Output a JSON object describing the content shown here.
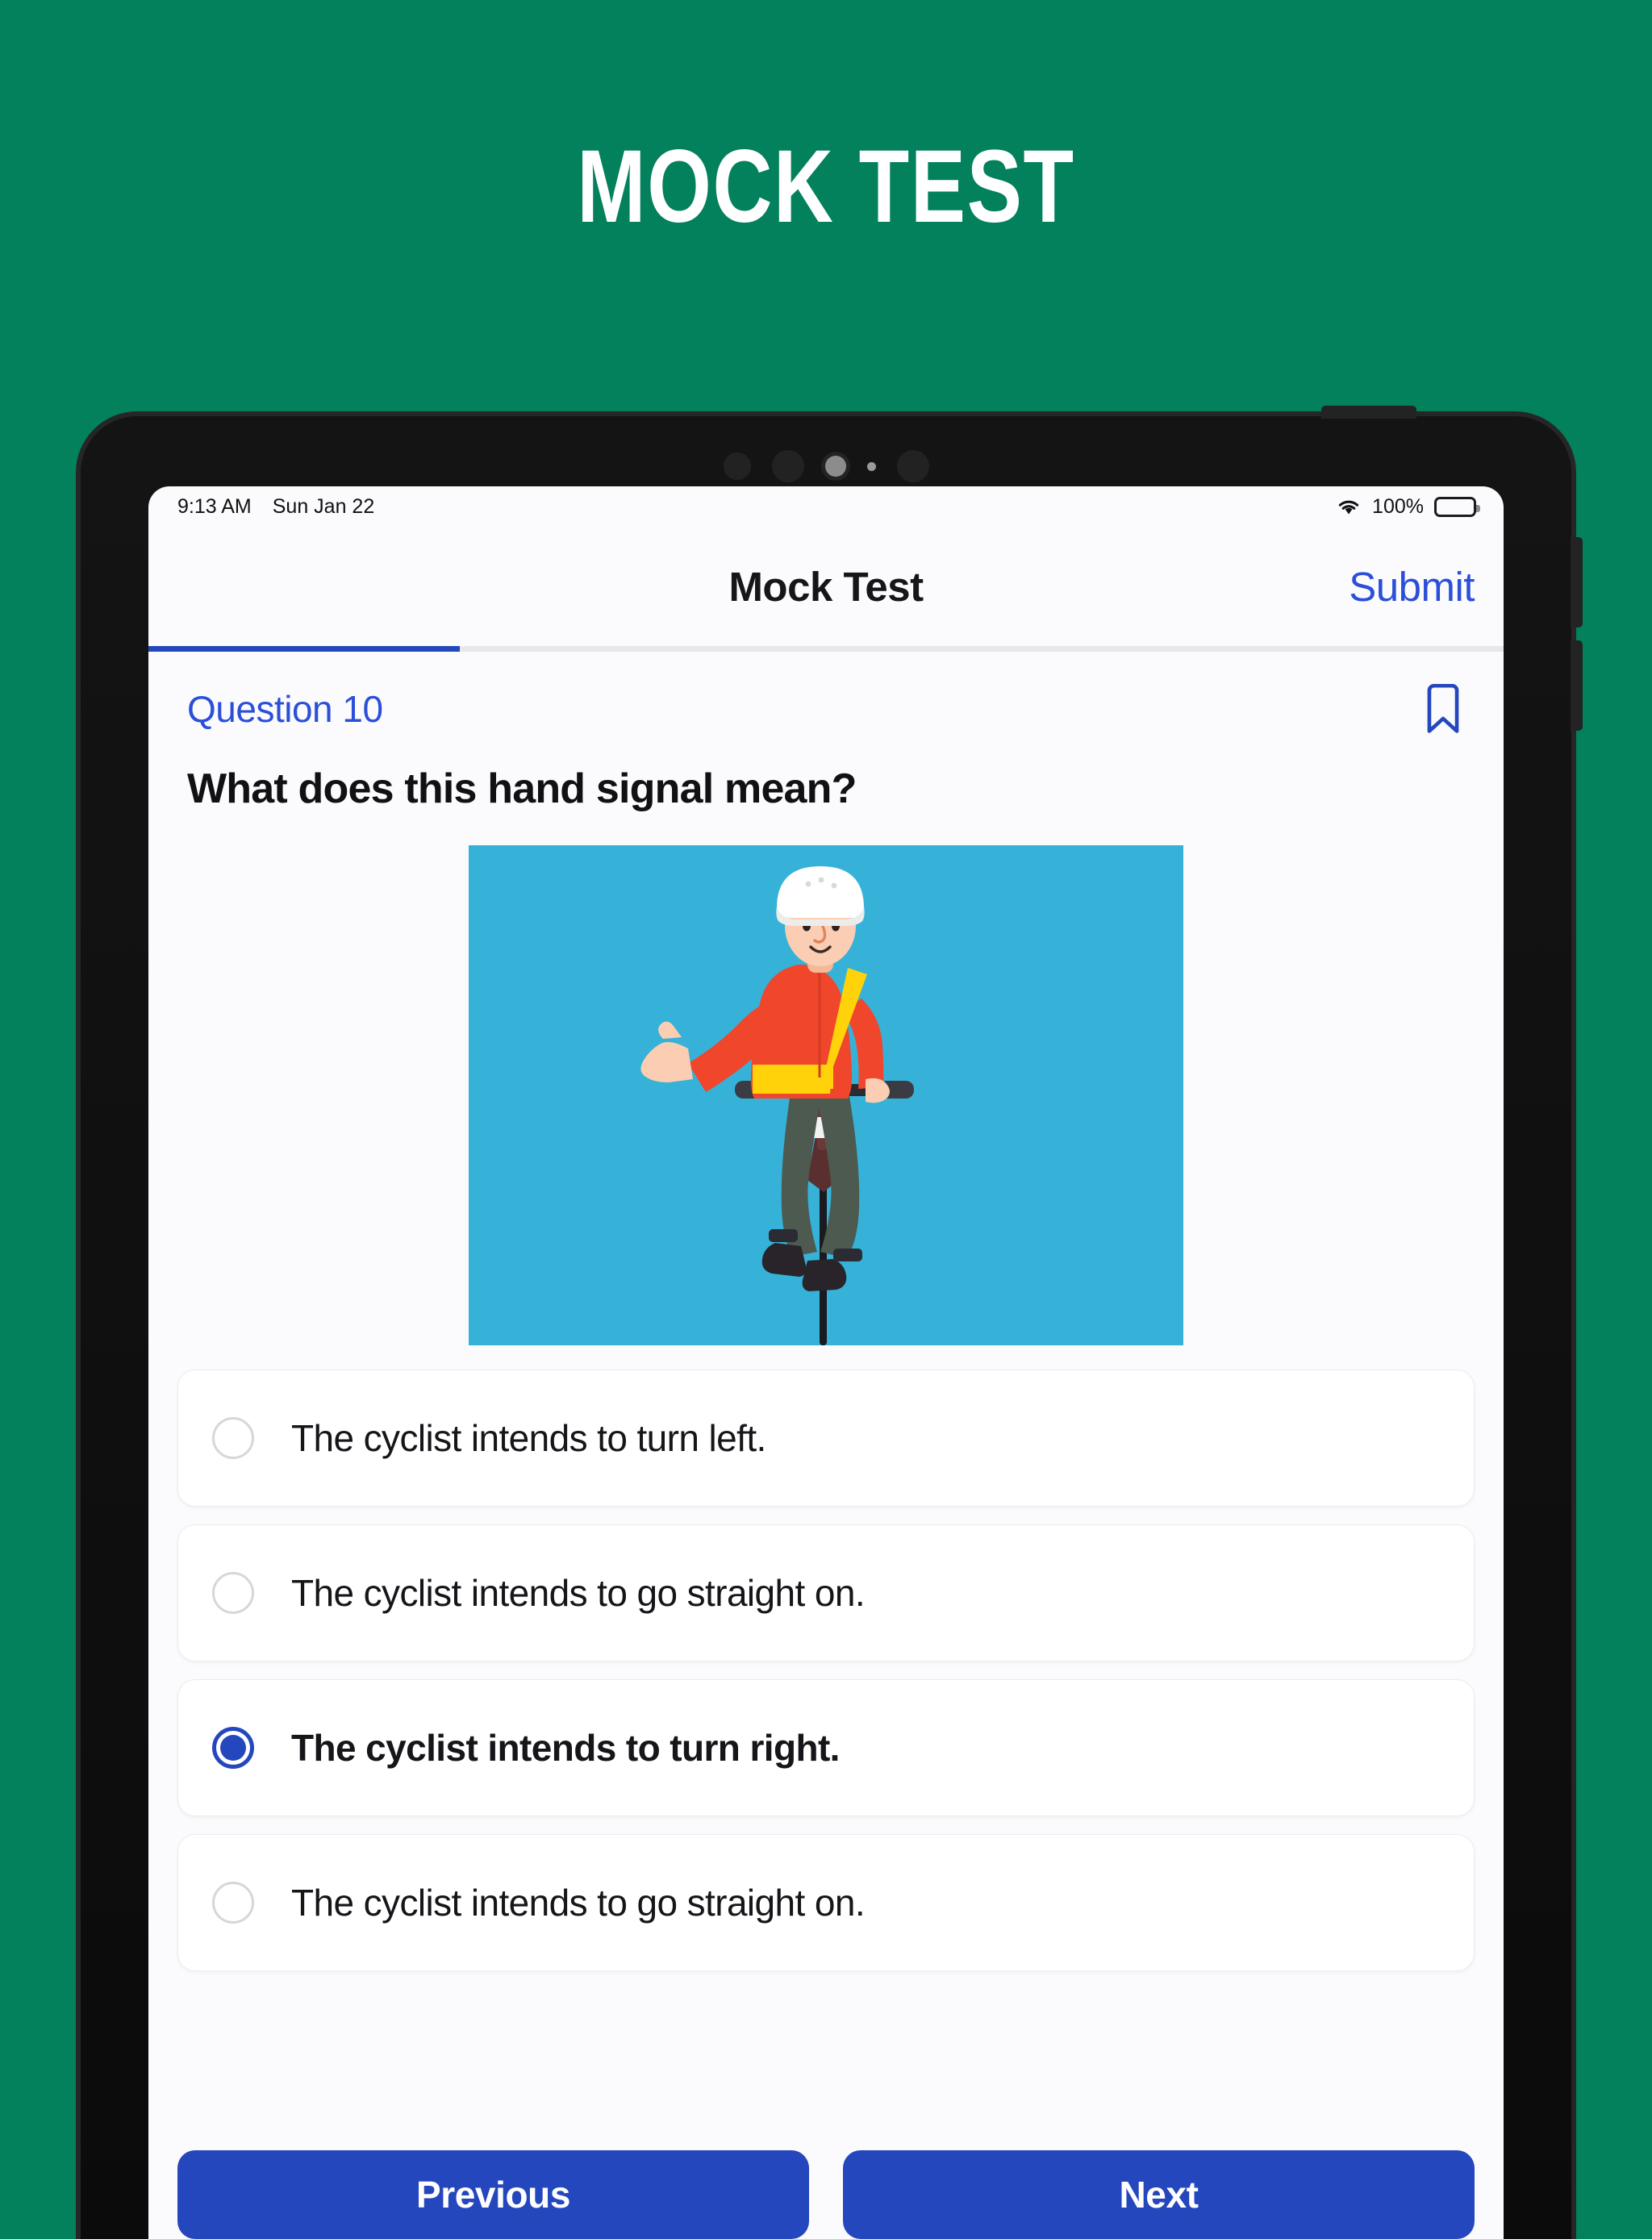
{
  "hero": {
    "title": "MOCK TEST"
  },
  "colors": {
    "background_green": "#03805C",
    "accent_blue": "#2547BE",
    "link_blue": "#2B4FD8",
    "image_background": "#36B2D9"
  },
  "device": {
    "status_bar": {
      "time": "9:13 AM",
      "date": "Sun Jan 22",
      "battery_percent": "100%",
      "wifi_icon": "wifi-icon",
      "battery_icon": "battery-icon"
    },
    "nav_bar": {
      "title": "Mock Test",
      "submit_label": "Submit"
    },
    "progress": {
      "percent": 23
    },
    "question": {
      "number_label": "Question 10",
      "bookmark_icon": "bookmark-icon",
      "text": "What does this hand signal mean?",
      "image_alt": "cyclist-hand-signal-illustration",
      "options": [
        {
          "label": "The cyclist intends to turn left.",
          "selected": false
        },
        {
          "label": "The cyclist intends to go straight on.",
          "selected": false
        },
        {
          "label": "The cyclist intends to turn right.",
          "selected": true
        },
        {
          "label": "The cyclist intends to go straight on.",
          "selected": false
        }
      ]
    },
    "footer": {
      "previous_label": "Previous",
      "next_label": "Next"
    }
  }
}
